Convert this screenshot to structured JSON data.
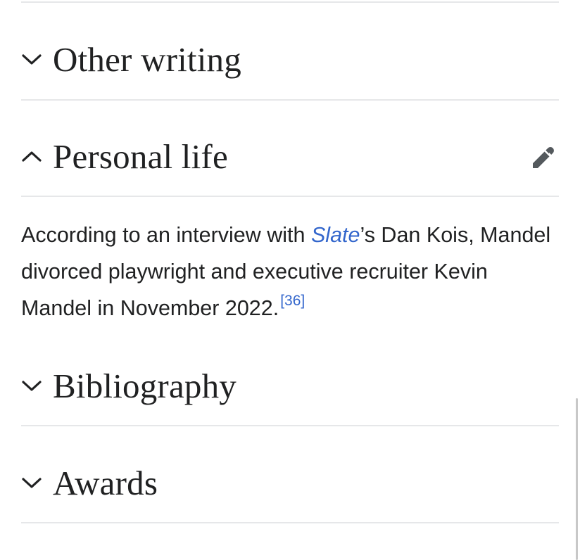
{
  "sections": {
    "other_writing": {
      "title": "Other writing",
      "expanded": false,
      "icon": "chevron-down-icon"
    },
    "personal_life": {
      "title": "Personal life",
      "expanded": true,
      "icon": "chevron-up-icon",
      "edit_icon": "pencil-icon"
    },
    "bibliography": {
      "title": "Bibliography",
      "expanded": false,
      "icon": "chevron-down-icon"
    },
    "awards": {
      "title": "Awards",
      "expanded": false,
      "icon": "chevron-down-icon"
    }
  },
  "personal_life_text": {
    "part1": "According to an interview with ",
    "link": "Slate",
    "part2": "’s Dan Kois, Mandel divorced playwright and executive recruiter Kevin Mandel in November 2022.",
    "citation": "[36]"
  },
  "colors": {
    "link": "#3366cc",
    "text": "#202122",
    "divider": "#e6e7e9",
    "icon": "#54595d"
  }
}
